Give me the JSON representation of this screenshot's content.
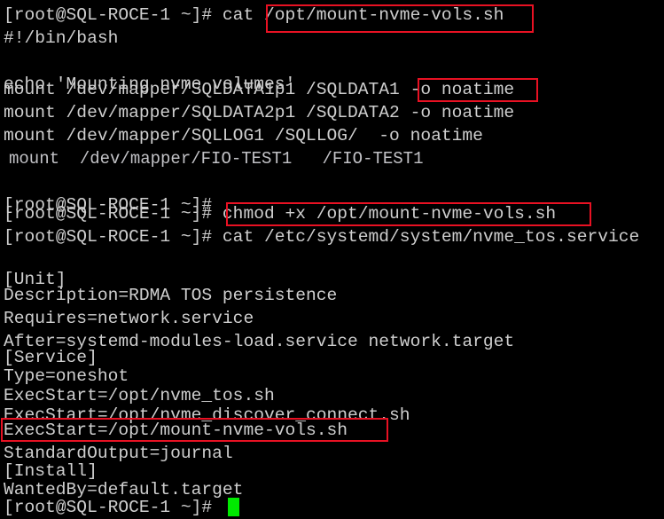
{
  "terminal": {
    "shell_prompt": "[root@SQL-ROCE-1 ~]#",
    "hostname": "SQL-ROCE-1",
    "user": "root",
    "cwd": "~",
    "background_color": "#000000",
    "text_color": "#cfcfcf",
    "cursor_color": "#00ea00",
    "annotation_color": "#e81123",
    "lines": [
      {
        "id": "l00",
        "text": "[root@SQL-ROCE-1 ~]# cat /opt/mount-nvme-vols.sh"
      },
      {
        "id": "l01",
        "text": "#!/bin/bash"
      },
      {
        "id": "l02",
        "text": ""
      },
      {
        "id": "l03",
        "text": "echo 'Mounting nvme volumes'"
      },
      {
        "id": "l04",
        "text": "mount /dev/mapper/SQLDATA1p1 /SQLDATA1 -o noatime"
      },
      {
        "id": "l05",
        "text": "mount /dev/mapper/SQLDATA2p1 /SQLDATA2 -o noatime"
      },
      {
        "id": "l06",
        "text": "mount /dev/mapper/SQLLOG1 /SQLLOG/  -o noatime"
      },
      {
        "id": "l07",
        "text": "mount  /dev/mapper/FIO-TEST1   /FIO-TEST1"
      },
      {
        "id": "l08",
        "text": ""
      },
      {
        "id": "l09",
        "text": "[root@SQL-ROCE-1 ~]#"
      },
      {
        "id": "l10",
        "text": "[root@SQL-ROCE-1 ~]# chmod +x /opt/mount-nvme-vols.sh"
      },
      {
        "id": "l11",
        "text": "[root@SQL-ROCE-1 ~]# cat /etc/systemd/system/nvme_tos.service"
      },
      {
        "id": "l12",
        "text": ""
      },
      {
        "id": "l13",
        "text": "[Unit]"
      },
      {
        "id": "l14",
        "text": "Description=RDMA TOS persistence"
      },
      {
        "id": "l15",
        "text": "Requires=network.service"
      },
      {
        "id": "l16",
        "text": "After=systemd-modules-load.service network.target"
      },
      {
        "id": "l17",
        "text": "[Service]"
      },
      {
        "id": "l18",
        "text": "Type=oneshot"
      },
      {
        "id": "l19",
        "text": "ExecStart=/opt/nvme_tos.sh"
      },
      {
        "id": "l20",
        "text": "ExecStart=/opt/nvme_discover_connect.sh"
      },
      {
        "id": "l21",
        "text": "ExecStart=/opt/mount-nvme-vols.sh"
      },
      {
        "id": "l22",
        "text": "StandardOutput=journal"
      },
      {
        "id": "l23",
        "text": "[Install]"
      },
      {
        "id": "l24",
        "text": "WantedBy=default.target"
      },
      {
        "id": "l25",
        "text": "[root@SQL-ROCE-1 ~]#"
      }
    ],
    "annotations": [
      {
        "id": "a0",
        "label": "/opt/mount-nvme-vols.sh"
      },
      {
        "id": "a1",
        "label": "-o noatime"
      },
      {
        "id": "a2",
        "label": "chmod +x /opt/mount-nvme-vols.sh"
      },
      {
        "id": "a3",
        "label": "ExecStart=/opt/mount-nvme-vols.sh"
      }
    ]
  }
}
